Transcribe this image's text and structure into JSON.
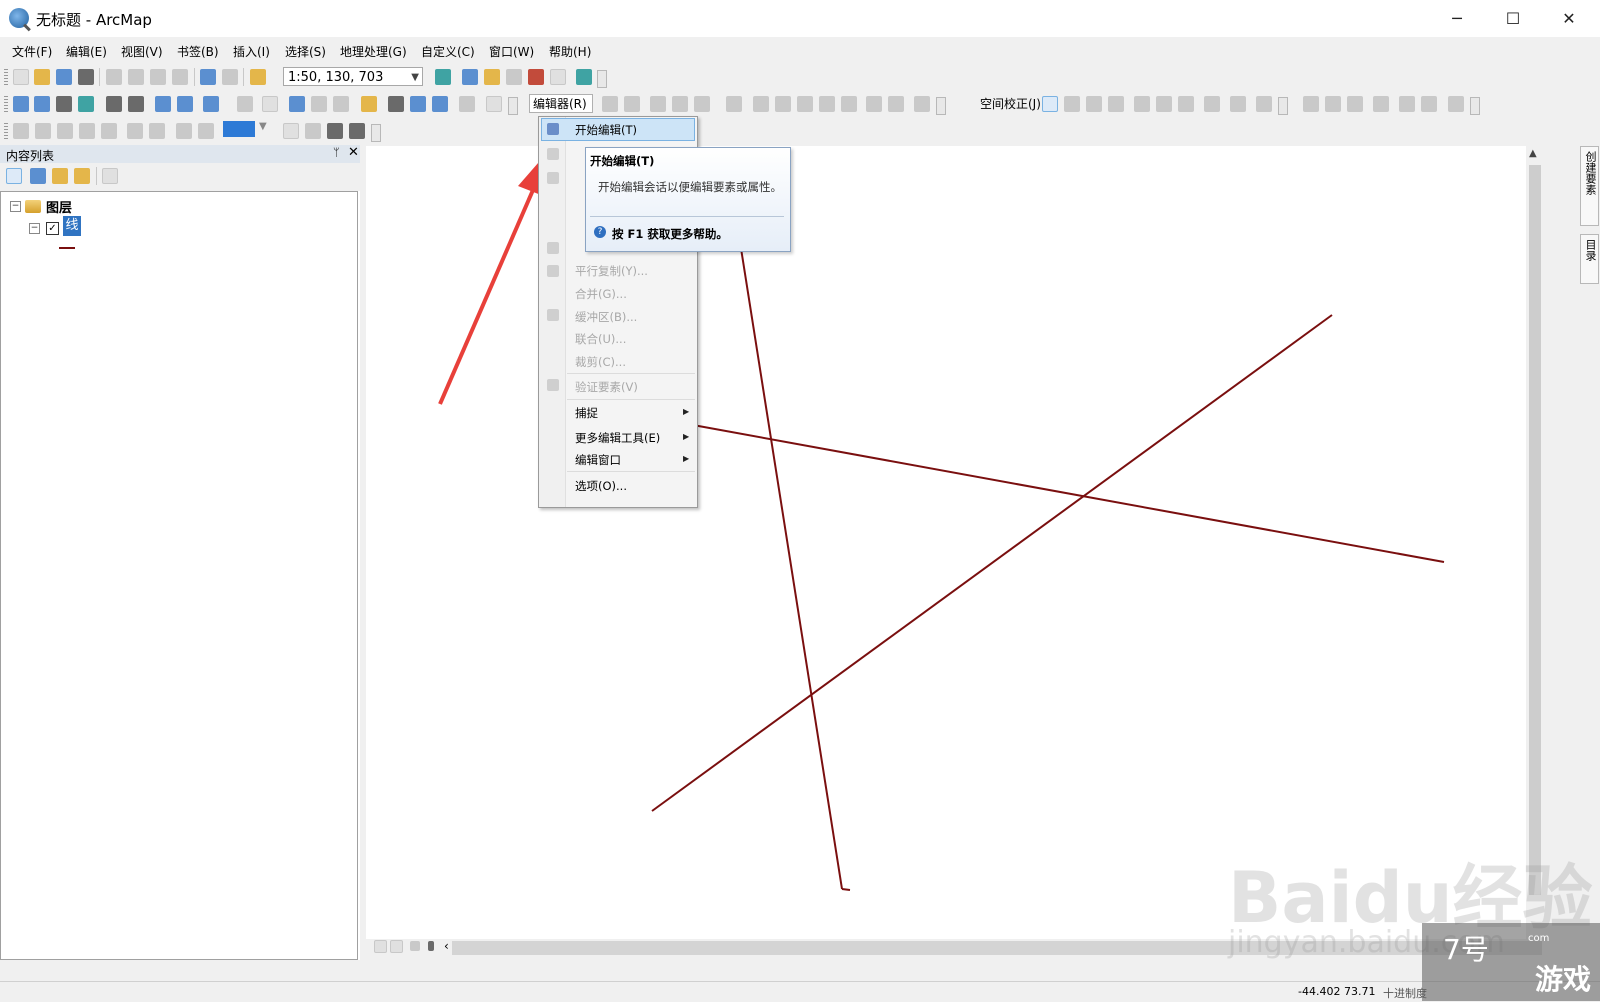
{
  "window": {
    "title": "无标题 - ArcMap",
    "minimize": "─",
    "maximize": "☐",
    "close": "✕"
  },
  "menubar": [
    "文件(F)",
    "编辑(E)",
    "视图(V)",
    "书签(B)",
    "插入(I)",
    "选择(S)",
    "地理处理(G)",
    "自定义(C)",
    "窗口(W)",
    "帮助(H)"
  ],
  "toolbar": {
    "scale": "1:50, 130, 703",
    "editor_label": "编辑器(R)",
    "spatial_adjust_label": "空间校正(J)"
  },
  "toc": {
    "title": "内容列表",
    "pin": "ᛘ",
    "close": "✕",
    "root_label": "图层",
    "layer_label": "线",
    "layer_checked": "✓",
    "expand_symbol": "⊟"
  },
  "editor_menu": {
    "items": [
      {
        "label": "开始编辑(T)",
        "enabled": true,
        "highlighted": true
      },
      {
        "label": "平行复制(Y)...",
        "enabled": false
      },
      {
        "label": "合并(G)...",
        "enabled": false
      },
      {
        "label": "缓冲区(B)...",
        "enabled": false
      },
      {
        "label": "联合(U)...",
        "enabled": false
      },
      {
        "label": "裁剪(C)...",
        "enabled": false
      },
      {
        "label": "验证要素(V)",
        "enabled": false
      },
      {
        "label": "捕捉",
        "enabled": true,
        "submenu": true
      },
      {
        "label": "更多编辑工具(E)",
        "enabled": true,
        "submenu": true
      },
      {
        "label": "编辑窗口",
        "enabled": true,
        "submenu": true
      },
      {
        "label": "选项(O)...",
        "enabled": true
      }
    ],
    "submenu_arrow": "▶"
  },
  "tooltip": {
    "title": "开始编辑(T)",
    "description": "开始编辑会话以便编辑要素或属性。",
    "help": "按 F1 获取更多帮助。",
    "help_icon": "?"
  },
  "map": {
    "line_color": "#7a0f0f",
    "annotation_arrow_color": "#e8403a"
  },
  "rightdock": {
    "tab1": "创建要素",
    "tab2": "目录"
  },
  "statusbar": {
    "coordinates": "-44.402  73.71",
    "units": "十进制度"
  },
  "watermark": {
    "baidu": "Baidu经验",
    "url": "jingyan.baidu.com",
    "corner_num": "7号",
    "corner_game": "游戏",
    "corner_com": "com"
  },
  "colors": {
    "selection": "#cde4f7",
    "accent_blue": "#3074c2"
  }
}
